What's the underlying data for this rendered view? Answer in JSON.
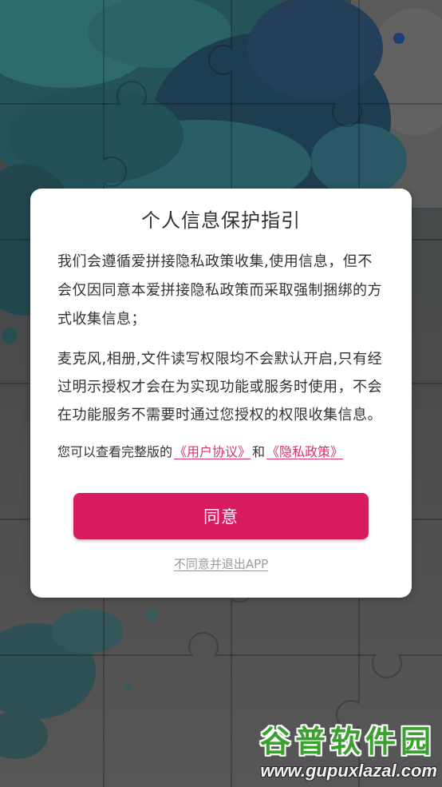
{
  "dialog": {
    "title": "个人信息保护指引",
    "paragraph1": [
      "我们会遵循爱拼接隐私政策收集,使用信息，但不",
      "会仅因同意本爱拼接隐私政策而采取强制捆绑的方",
      "式收集信息；"
    ],
    "paragraph2": [
      "麦克风,相册,文件读写权限均不会默认开启,只有经",
      "过明示授权才会在为实现功能或服务时使用，不会",
      "在功能服务不需要时通过您授权的权限收集信息。"
    ],
    "links_intro": "您可以查看完整版的",
    "user_agreement_link": "《用户协议》",
    "conjunction": "和",
    "privacy_policy_link": "《隐私政策》",
    "agree_button": "同意",
    "disagree_link": "不同意并退出APP"
  },
  "watermark": {
    "brand": "谷普软件园",
    "url": "www.gupuxlazal.com"
  },
  "colors": {
    "accent": "#d81b60",
    "link": "#d6336c",
    "muted_text": "#9a9a9a",
    "body_text": "#333333",
    "watermark_green": "#3aa12f"
  }
}
